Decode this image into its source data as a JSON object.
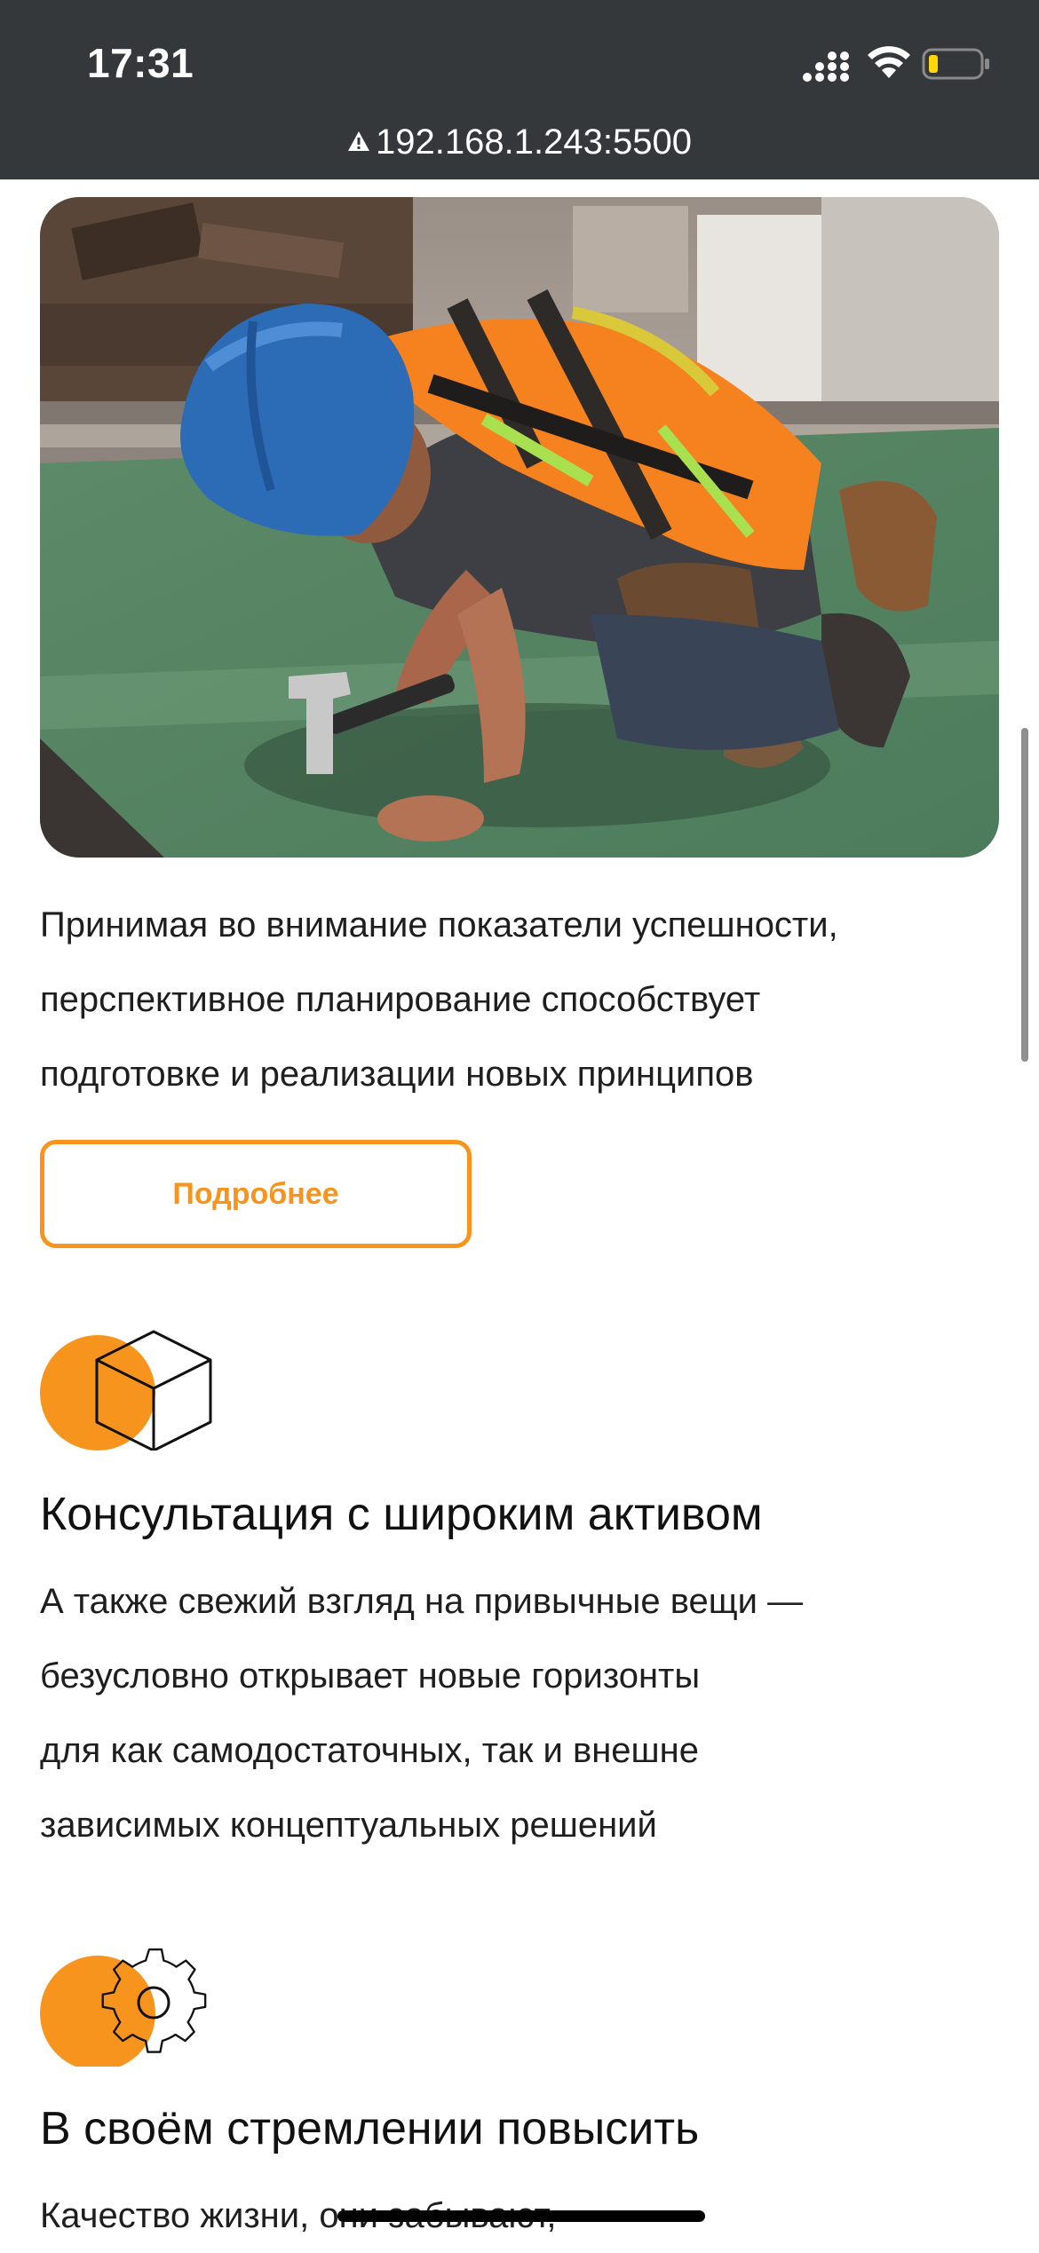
{
  "status_bar": {
    "time": "17:31"
  },
  "browser": {
    "url": "192.168.1.243:5500"
  },
  "hero": {
    "image_alt": "worker-in-hard-hat-with-hammer-photo"
  },
  "intro": {
    "lines": [
      "Принимая во внимание показатели успешности,",
      "перспективное планирование способствует",
      "подготовке и реализации новых принципов"
    ],
    "button_label": "Подробнее"
  },
  "features": [
    {
      "icon": "cube-icon",
      "title": "Консультация с широким активом",
      "lines": [
        "А также свежий взгляд на привычные вещи —",
        "безусловно открывает новые горизонты",
        "для как самодостаточных, так и внешне",
        "зависимых концептуальных решений"
      ]
    },
    {
      "icon": "gear-icon",
      "title": "В своём стремлении повысить",
      "lines": [
        "Качество жизни, они забывают,"
      ]
    }
  ],
  "colors": {
    "accent": "#f7941d",
    "top_bar": "#35383b",
    "text": "#1e1e1e",
    "battery_fill": "#ffd60a"
  }
}
